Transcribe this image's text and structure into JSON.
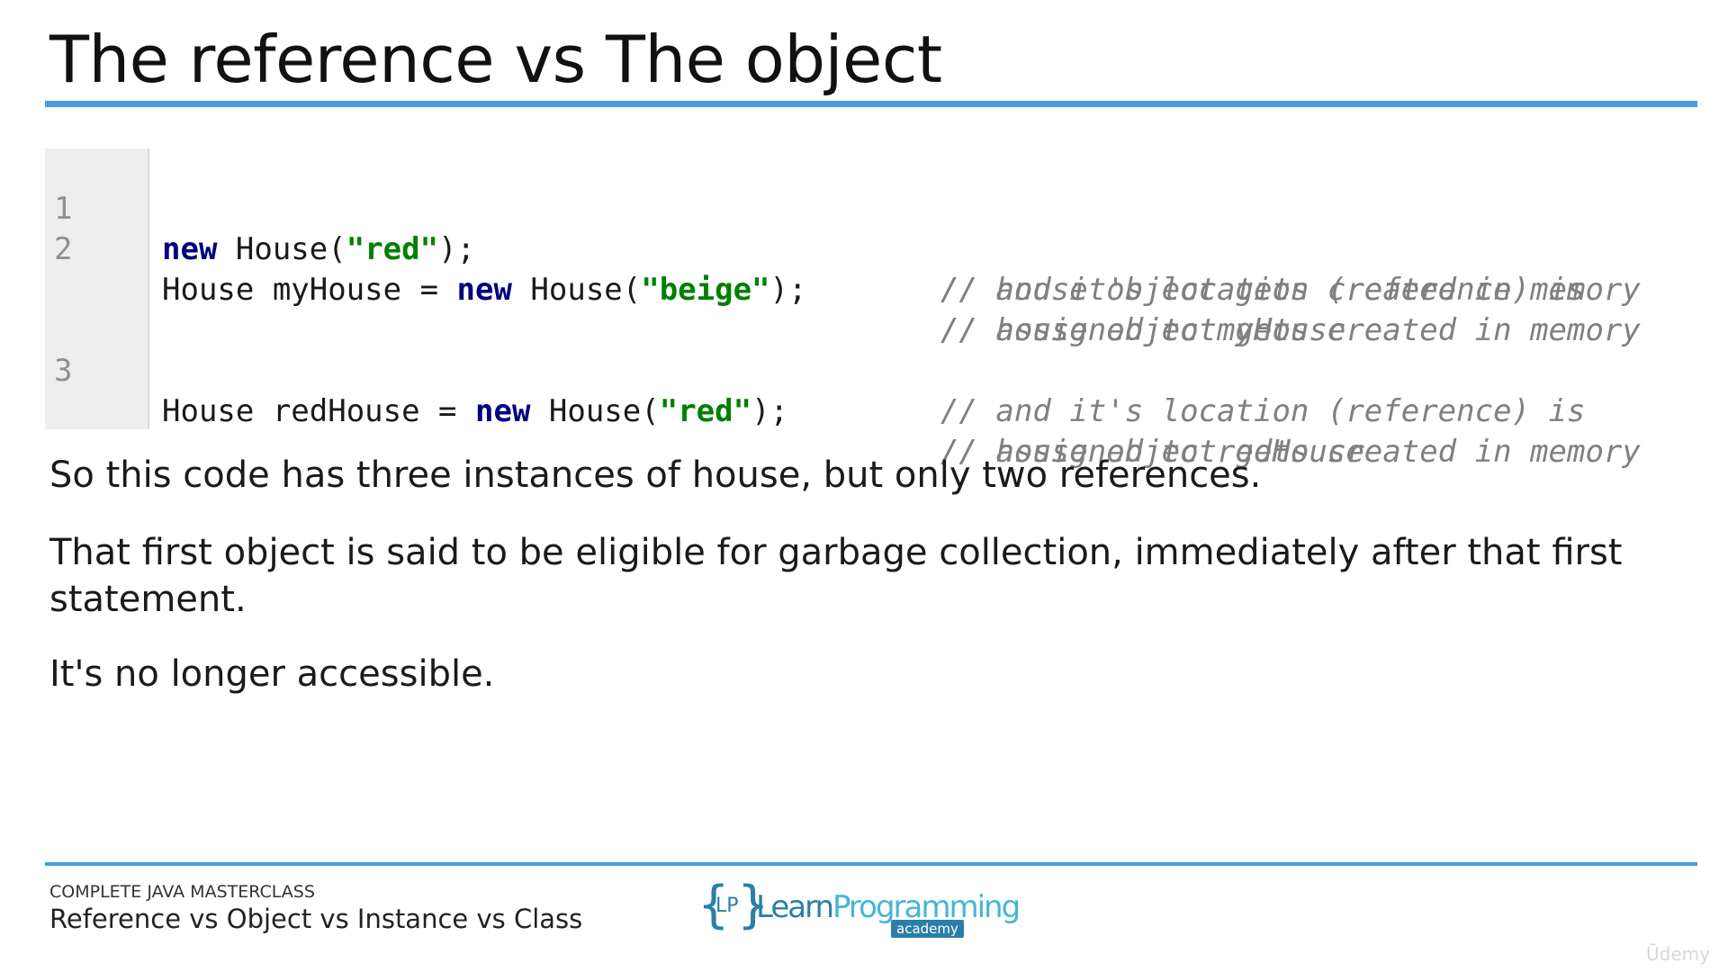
{
  "slide": {
    "title": "The reference vs The object",
    "code_lines": [
      {
        "number": "1",
        "comment_lines": [
          "// house object gets created in memory"
        ]
      },
      {
        "number": "2",
        "comment_lines": [
          "// house object gets created in memory",
          "// and it's location (reference) is",
          "// assigned to myHouse"
        ]
      },
      {
        "number": "3",
        "comment_lines": [
          "// house object gets created in memory",
          "// and it's location (reference) is",
          "// assigned to redHouse"
        ]
      }
    ],
    "code": {
      "l1": {
        "kw": "new",
        "a": " House(",
        "str": "\"red\"",
        "b": ");"
      },
      "l2": {
        "a": "House myHouse = ",
        "kw": "new",
        "b": " House(",
        "str": "\"beige\"",
        "c": ");"
      },
      "l3": {
        "a": "House redHouse = ",
        "kw": "new",
        "b": " House(",
        "str": "\"red\"",
        "c": ");"
      }
    },
    "paragraphs": [
      "So this code has three instances of house, but only two references.",
      "That first object is said to be eligible for garbage collection, immediately after that first statement.",
      "It's no longer accessible."
    ]
  },
  "footer": {
    "course": "COMPLETE JAVA MASTERCLASS",
    "lecture": "Reference vs Object vs Instance vs Class",
    "logo": {
      "left_brace": "{",
      "initials": "LP",
      "right_brace": "}",
      "word1": "Learn",
      "word2": "Programming",
      "tag": "academy"
    },
    "watermark": "Ūdemy"
  },
  "colors": {
    "accent": "#4a9be0",
    "keyword": "#000080",
    "string": "#008000",
    "comment": "#808080",
    "brand": "#2a7fa8"
  }
}
